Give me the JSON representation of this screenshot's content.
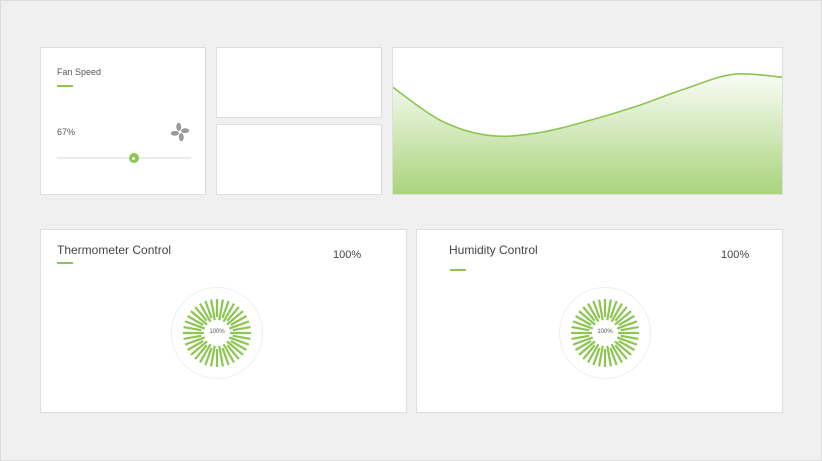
{
  "fan": {
    "title": "Fan Speed",
    "value_label": "67%",
    "value": 0.67,
    "icon": "fan-icon"
  },
  "chart_data": {
    "type": "area",
    "x": [
      0,
      1,
      2,
      3,
      4,
      5,
      6,
      7,
      8
    ],
    "values": [
      0.73,
      0.5,
      0.4,
      0.42,
      0.5,
      0.6,
      0.72,
      0.82,
      0.8
    ],
    "ylim": [
      0,
      1
    ],
    "xlabel": "",
    "ylabel": "",
    "grid": false
  },
  "thermometer": {
    "title": "Thermometer Control",
    "value_label": "100%",
    "dial_label": "100%",
    "value": 1.0
  },
  "humidity": {
    "title": "Humidity Control",
    "value_label": "100%",
    "dial_label": "100%",
    "value": 1.0
  },
  "colors": {
    "accent": "#8dc551",
    "card": "#ffffff",
    "background": "#f0f0f0"
  }
}
